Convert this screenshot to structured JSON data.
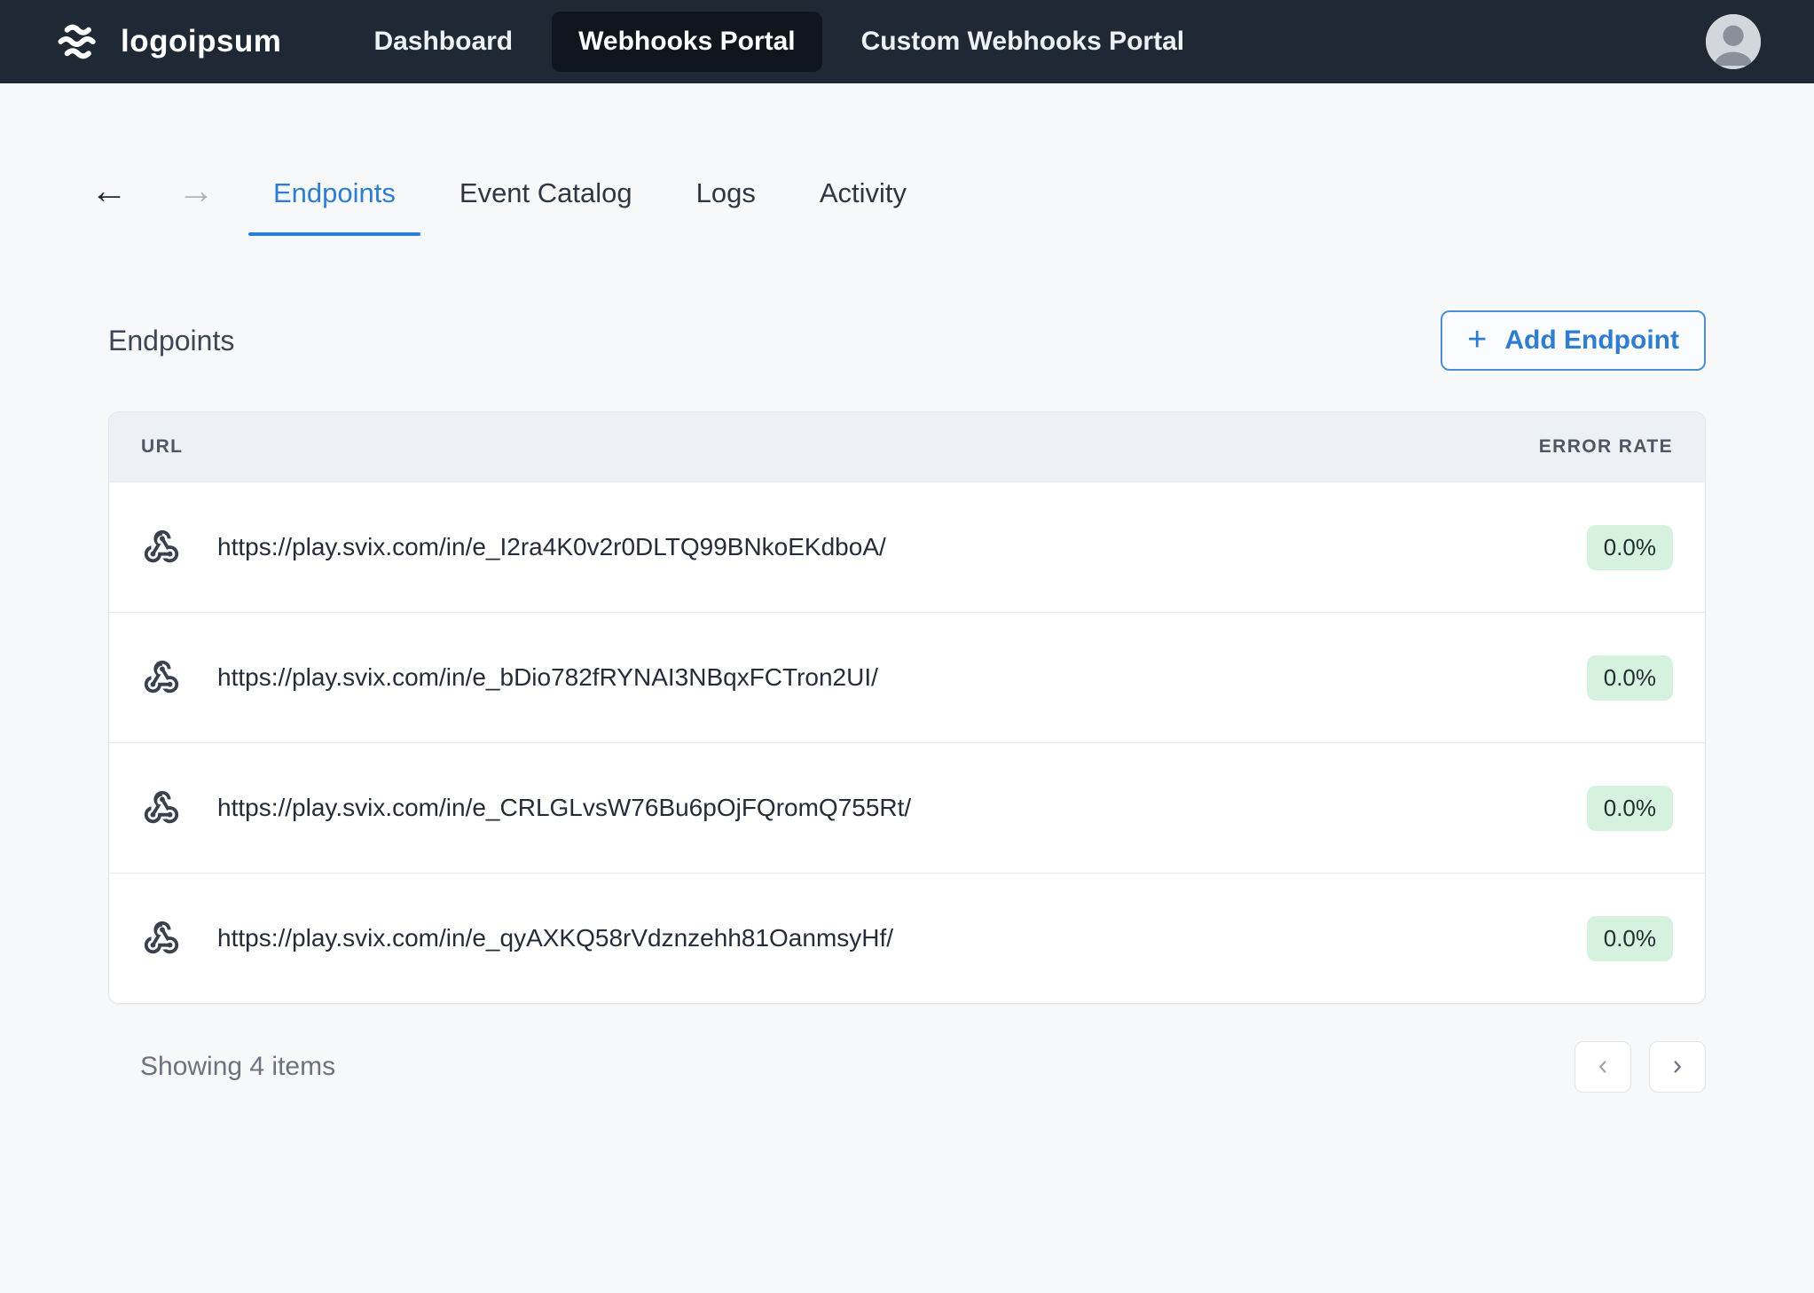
{
  "brand": {
    "logo_text": "logoipsum"
  },
  "nav": {
    "items": [
      {
        "label": "Dashboard",
        "active": false
      },
      {
        "label": "Webhooks Portal",
        "active": true
      },
      {
        "label": "Custom Webhooks Portal",
        "active": false
      }
    ]
  },
  "icons": {
    "back_arrow": "←",
    "forward_arrow": "→",
    "plus": "+",
    "logo_mark": "waves-icon",
    "row_icon": "webhook-icon",
    "pager_prev": "chevron-left-icon",
    "pager_next": "chevron-right-icon"
  },
  "tabs": [
    {
      "label": "Endpoints",
      "active": true
    },
    {
      "label": "Event Catalog",
      "active": false
    },
    {
      "label": "Logs",
      "active": false
    },
    {
      "label": "Activity",
      "active": false
    }
  ],
  "page": {
    "title": "Endpoints",
    "add_button_label": "Add Endpoint"
  },
  "table": {
    "columns": [
      "URL",
      "ERROR RATE"
    ],
    "rows": [
      {
        "url": "https://play.svix.com/in/e_I2ra4K0v2r0DLTQ99BNkoEKdboA/",
        "error_rate": "0.0%"
      },
      {
        "url": "https://play.svix.com/in/e_bDio782fRYNAI3NBqxFCTron2UI/",
        "error_rate": "0.0%"
      },
      {
        "url": "https://play.svix.com/in/e_CRLGLvsW76Bu6pOjFQromQ755Rt/",
        "error_rate": "0.0%"
      },
      {
        "url": "https://play.svix.com/in/e_qyAXKQ58rVdznzehh81OanmsyHf/",
        "error_rate": "0.0%"
      }
    ]
  },
  "footer": {
    "summary": "Showing 4 items"
  },
  "colors": {
    "navbar_bg": "#1f2935",
    "accent_blue": "#2e7dd1",
    "badge_green_bg": "#d5f2de",
    "page_bg": "#f6f8fa"
  }
}
